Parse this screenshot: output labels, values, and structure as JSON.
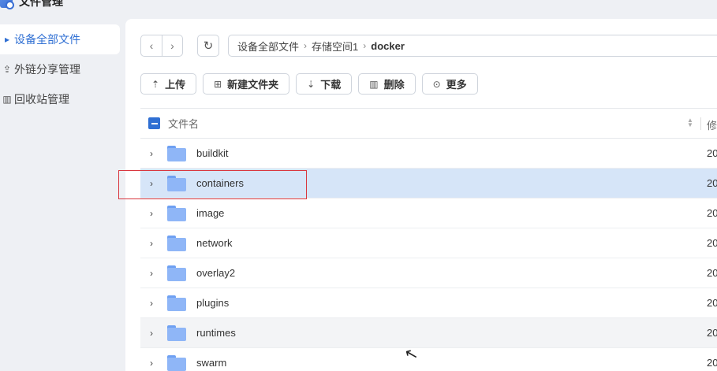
{
  "app": {
    "title": "文件管理"
  },
  "sidebar": {
    "items": [
      {
        "label": "设备全部文件",
        "icon": "caret-right-icon",
        "active": true
      },
      {
        "label": "外链分享管理",
        "icon": "share-icon",
        "active": false
      },
      {
        "label": "回收站管理",
        "icon": "trash-icon",
        "active": false
      }
    ]
  },
  "path": {
    "segments": [
      "设备全部文件",
      "存储空间1",
      "docker"
    ],
    "separator": "›"
  },
  "toolbar": {
    "upload": "上传",
    "new_folder": "新建文件夹",
    "download": "下载",
    "delete": "删除",
    "more": "更多"
  },
  "table": {
    "col_name": "文件名",
    "col_modified": "修",
    "rows": [
      {
        "name": "buildkit",
        "date": "20"
      },
      {
        "name": "containers",
        "date": "20"
      },
      {
        "name": "image",
        "date": "20"
      },
      {
        "name": "network",
        "date": "20"
      },
      {
        "name": "overlay2",
        "date": "20"
      },
      {
        "name": "plugins",
        "date": "20"
      },
      {
        "name": "runtimes",
        "date": "20"
      },
      {
        "name": "swarm",
        "date": "20"
      }
    ]
  },
  "colors": {
    "accent": "#2f6fd3",
    "selected_row": "#d6e5f8",
    "highlight_box": "#d9363e"
  }
}
